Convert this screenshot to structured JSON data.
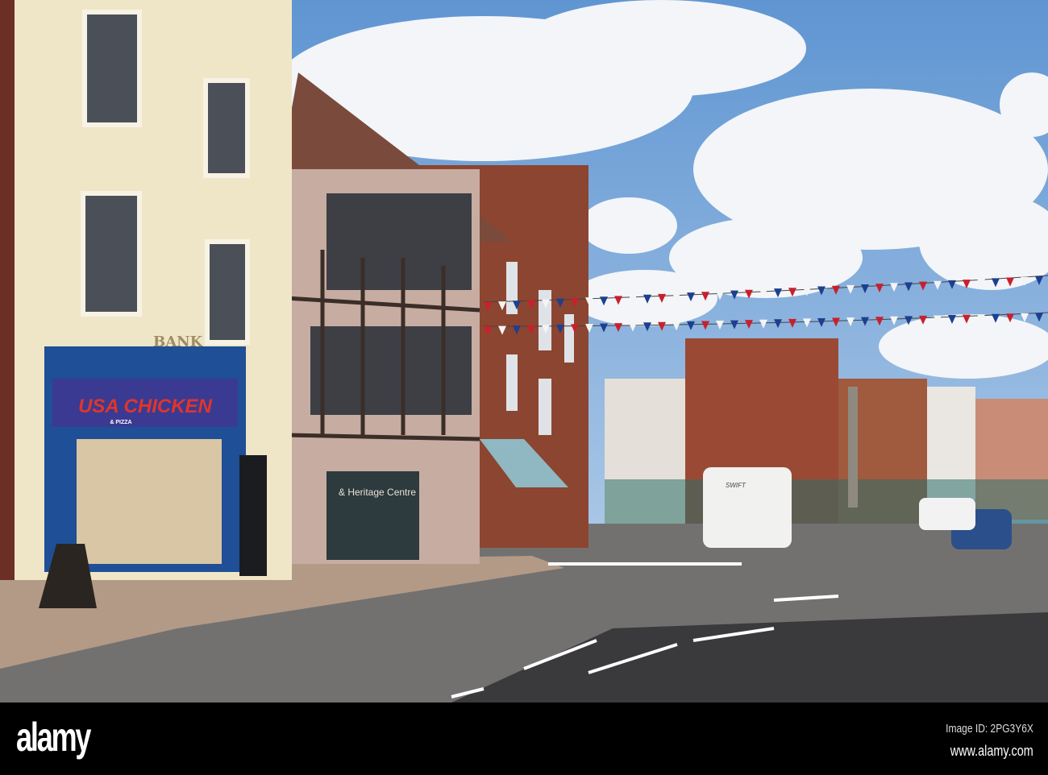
{
  "shopfront": {
    "name": "USA CHICKEN",
    "sub": "& PIZZA"
  },
  "building_sign": "BANK",
  "heritage_sign": "& Heritage Centre",
  "motorhome_badge": "SWIFT",
  "watermark": {
    "logo": "alamy",
    "image_id": "Image ID: 2PG3Y6X",
    "url": "www.alamy.com"
  },
  "colors": {
    "sky": "#6d9fd6",
    "shopfront_blue": "#1f4f96",
    "sign_red": "#e0352b",
    "brick": "#9a4a34",
    "road": "#6e6c6a"
  }
}
